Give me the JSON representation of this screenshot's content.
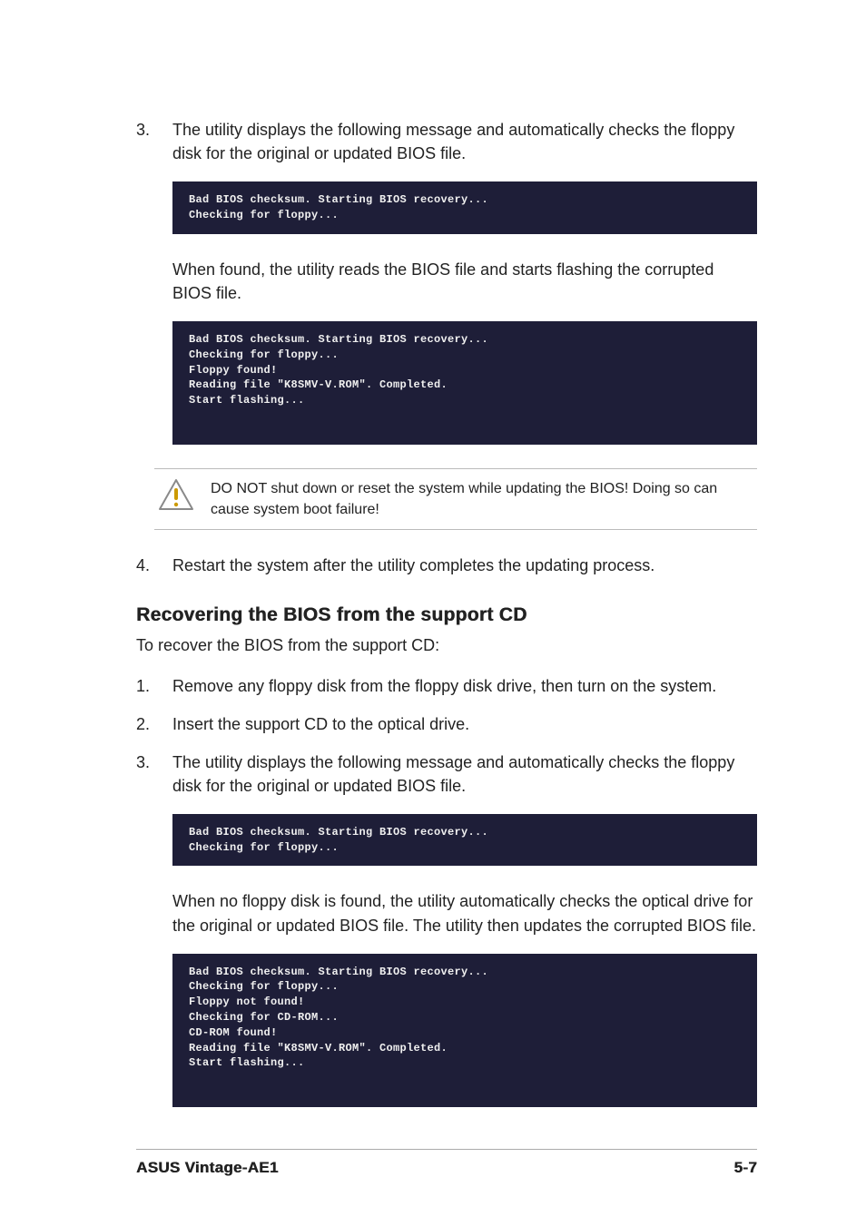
{
  "step3": {
    "num": "3.",
    "text": "The utility displays the following message and automatically checks the floppy disk for the original or updated BIOS file."
  },
  "term1": "Bad BIOS checksum. Starting BIOS recovery...\nChecking for floppy...",
  "foundText": "When found, the utility reads the BIOS file and starts flashing the corrupted BIOS file.",
  "term2": "Bad BIOS checksum. Starting BIOS recovery...\nChecking for floppy...\nFloppy found!\nReading file \"K8SMV-V.ROM\". Completed.\nStart flashing...",
  "callout": "DO NOT shut down or reset the system while updating the BIOS! Doing so can cause system boot failure!",
  "step4": {
    "num": "4.",
    "text": "Restart the system after the utility completes the updating process."
  },
  "heading2": "Recovering the BIOS from the support CD",
  "subtext": "To recover the BIOS from the support CD:",
  "cdStep1": {
    "num": "1.",
    "text": "Remove any floppy disk from the floppy disk drive, then turn on the system."
  },
  "cdStep2": {
    "num": "2.",
    "text": "Insert the support CD to the optical drive."
  },
  "cdStep3": {
    "num": "3.",
    "text": "The utility displays the following message and automatically checks the floppy disk for the original or updated BIOS file."
  },
  "term3": "Bad BIOS checksum. Starting BIOS recovery...\nChecking for floppy...",
  "noFloppyText": "When no floppy disk is found, the utility automatically checks the optical drive for the original or updated BIOS file. The utility then updates the corrupted BIOS file.",
  "term4": "Bad BIOS checksum. Starting BIOS recovery...\nChecking for floppy...\nFloppy not found!\nChecking for CD-ROM...\nCD-ROM found!\nReading file \"K8SMV-V.ROM\". Completed.\nStart flashing...",
  "footer": {
    "left": "ASUS Vintage-AE1",
    "right": "5-7"
  }
}
